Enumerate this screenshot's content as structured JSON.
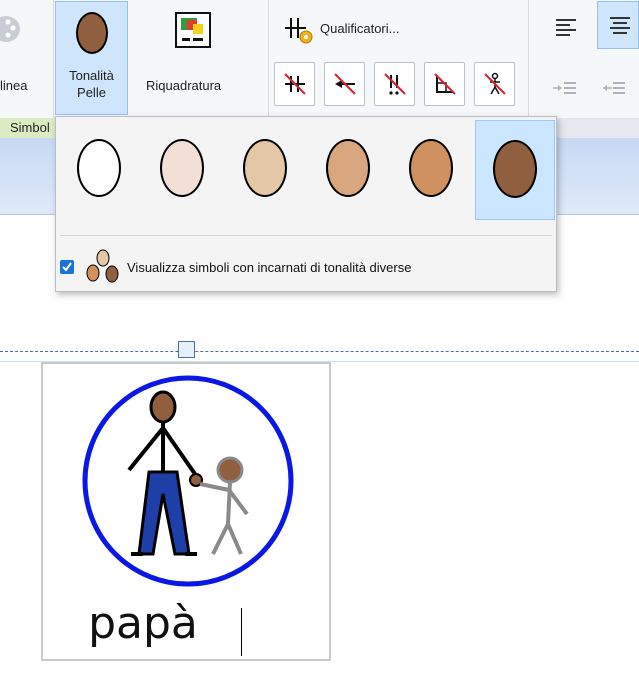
{
  "ribbon": {
    "outline_label_partial": "linea",
    "skin_tone_label_line1": "Tonalità",
    "skin_tone_label_line2": "Pelle",
    "reframe_label": "Riquadratura",
    "qualifiers_label": "Qualificatori...",
    "group_symbol_label": "Simbol"
  },
  "skin_tone_popup": {
    "tones": [
      {
        "color": "#ffffff",
        "selected": false
      },
      {
        "color": "#f2e0d6",
        "selected": false
      },
      {
        "color": "#e3c7a6",
        "selected": false
      },
      {
        "color": "#d9a77f",
        "selected": false
      },
      {
        "color": "#cf915f",
        "selected": false
      },
      {
        "color": "#8f5f40",
        "selected": true
      }
    ],
    "checkbox_checked": true,
    "checkbox_label": "Visualizza simboli con incarnati di tonalità diverse"
  },
  "document": {
    "symbol_word": "papà",
    "circle_color": "#0a17e6"
  }
}
